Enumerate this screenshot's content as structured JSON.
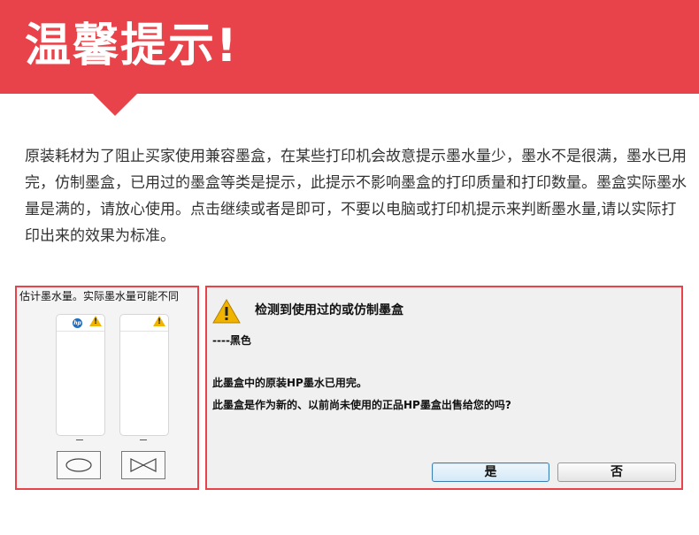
{
  "banner": {
    "title": "温馨提示!",
    "color": "#e8434a"
  },
  "description": "原装耗材为了阻止买家使用兼容墨盒，在某些打印机会故意提示墨水量少，墨水不是很满，墨水已用完，仿制墨盒，已用过的墨盒等类是提示，此提示不影响墨盒的打印质量和打印数量。墨盒实际墨水量是满的，请放心使用。点击继续或者是即可，不要以电脑或打印机提示来判断墨水量,请以实际打印出来的效果为标准。",
  "ink_panel": {
    "title": "估计墨水量。实际墨水量可能不同",
    "cartridge_left": {
      "logo": "hp",
      "dash": "--",
      "icon": "warning-icon",
      "shape": "ellipse-icon"
    },
    "cartridge_right": {
      "dash": "--",
      "icon": "warning-icon",
      "shape": "bowtie-icon"
    }
  },
  "dialog": {
    "heading": "检测到使用过的或仿制墨盒",
    "color_line": "----黑色",
    "message1": "此墨盒中的原装HP墨水已用完。",
    "message2": "此墨盒是作为新的、以前尚未使用的正品HP墨盒出售给您的吗?",
    "yes_label": "是",
    "no_label": "否",
    "warning_color": "#f0b400"
  }
}
